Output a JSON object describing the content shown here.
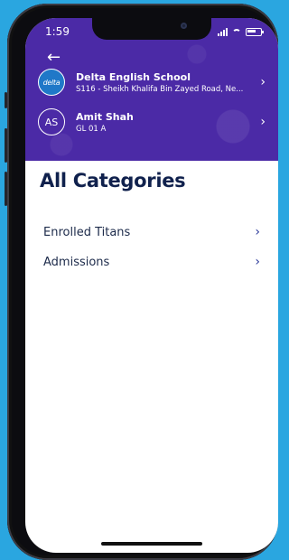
{
  "status_bar": {
    "time": "1:59"
  },
  "header": {
    "school": {
      "logo_text": "delta",
      "name": "Delta English School",
      "address": "S116 - Sheikh Khalifa Bin Zayed Road, Ne..."
    },
    "student": {
      "initials": "AS",
      "name": "Amit Shah",
      "class": "GL 01 A"
    }
  },
  "main": {
    "title": "All Categories",
    "items": [
      {
        "label": "Enrolled Titans"
      },
      {
        "label": "Admissions"
      }
    ]
  },
  "colors": {
    "header_bg": "#4b2aa6",
    "background": "#2aa6e0",
    "title": "#10214d",
    "chevron": "#2c3a9a"
  },
  "icons": {
    "back": "arrow-left-icon",
    "row_chevron": "chevron-right-icon"
  }
}
